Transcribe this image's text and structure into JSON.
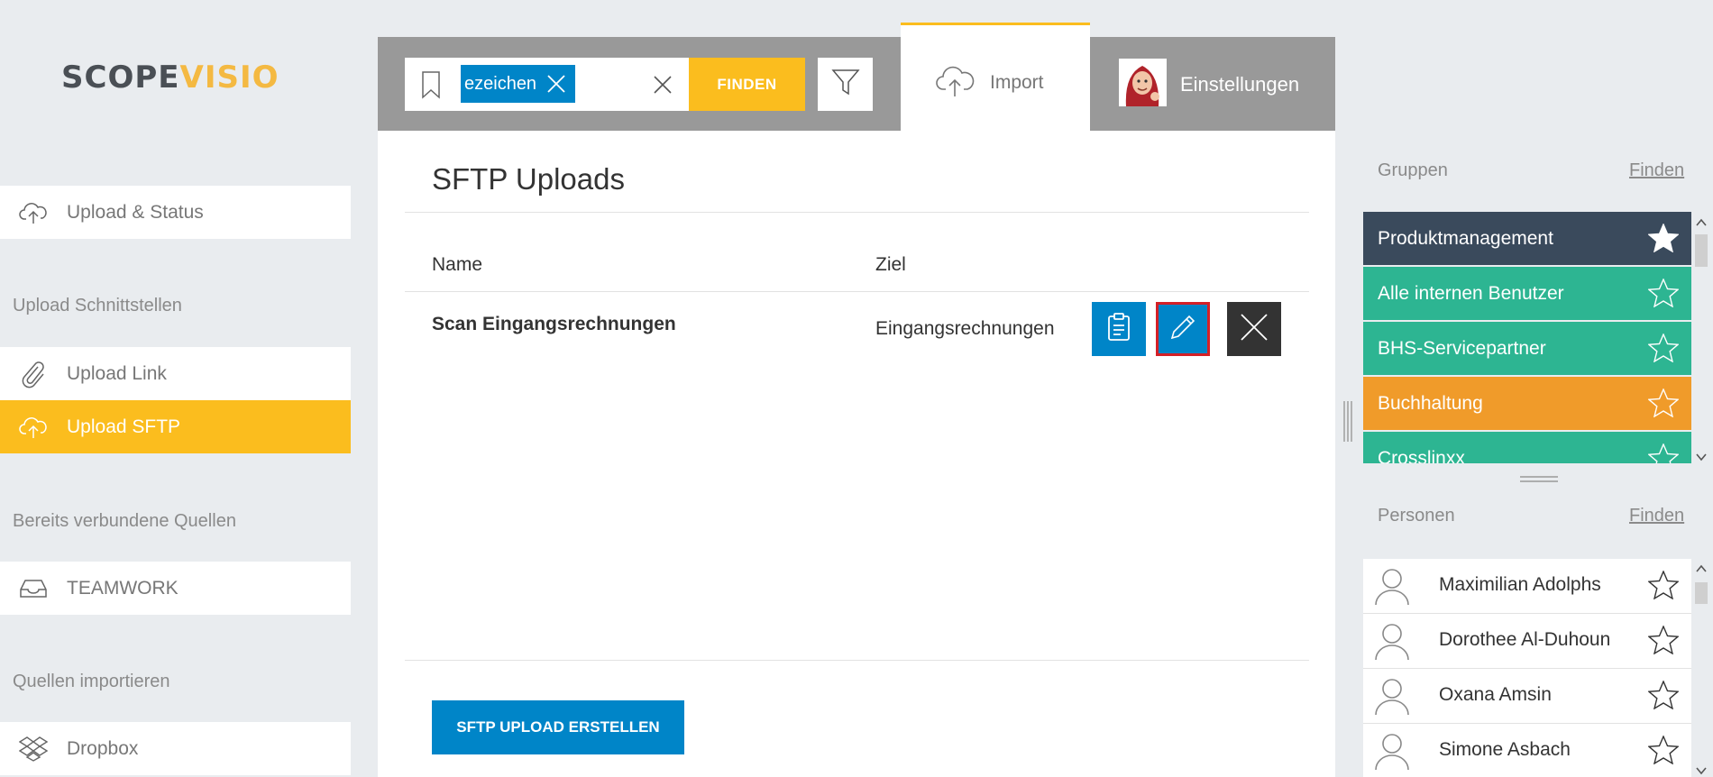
{
  "app": {
    "logo_part1": "SCOPE",
    "logo_part2": "VISIO"
  },
  "sidebar": {
    "items": [
      {
        "label": "Upload & Status",
        "icon": "cloud-upload-icon"
      },
      {
        "label": "Upload Link",
        "icon": "paperclip-icon"
      },
      {
        "label": "Upload SFTP",
        "icon": "cloud-upload-icon",
        "active": true
      },
      {
        "label": "TEAMWORK",
        "icon": "inbox-icon"
      },
      {
        "label": "Dropbox",
        "icon": "dropbox-icon"
      }
    ],
    "sections": [
      "Upload Schnittstellen",
      "Bereits verbundene Quellen",
      "Quellen importieren"
    ]
  },
  "topbar": {
    "search_tag": "ezeichen",
    "find_label": "FINDEN",
    "tab_import": "Import",
    "tab_settings": "Einstellungen"
  },
  "main": {
    "title": "SFTP Uploads",
    "columns": [
      "Name",
      "Ziel"
    ],
    "rows": [
      {
        "name": "Scan Eingangsrechnungen",
        "target": "Eingangsrechnungen"
      }
    ],
    "create_label": "SFTP UPLOAD ERSTELLEN"
  },
  "groups": {
    "title": "Gruppen",
    "find_label": "Finden",
    "items": [
      {
        "label": "Produktmanagement",
        "color": "#3a4a5c",
        "favorite": true
      },
      {
        "label": "Alle internen Benutzer",
        "color": "#2db592",
        "favorite": false
      },
      {
        "label": "BHS-Servicepartner",
        "color": "#2db592",
        "favorite": false
      },
      {
        "label": "Buchhaltung",
        "color": "#f09b2a",
        "favorite": false
      },
      {
        "label": "Crosslinxx",
        "color": "#2db592",
        "favorite": false
      }
    ]
  },
  "persons": {
    "title": "Personen",
    "find_label": "Finden",
    "items": [
      {
        "name": "Maximilian Adolphs"
      },
      {
        "name": "Dorothee Al-Duhoun"
      },
      {
        "name": "Oxana Amsin"
      },
      {
        "name": "Simone Asbach"
      }
    ]
  },
  "colors": {
    "accent_yellow": "#fbbd1e",
    "primary_blue": "#0085c8",
    "dark": "#333333",
    "highlight_red": "#d42027"
  }
}
